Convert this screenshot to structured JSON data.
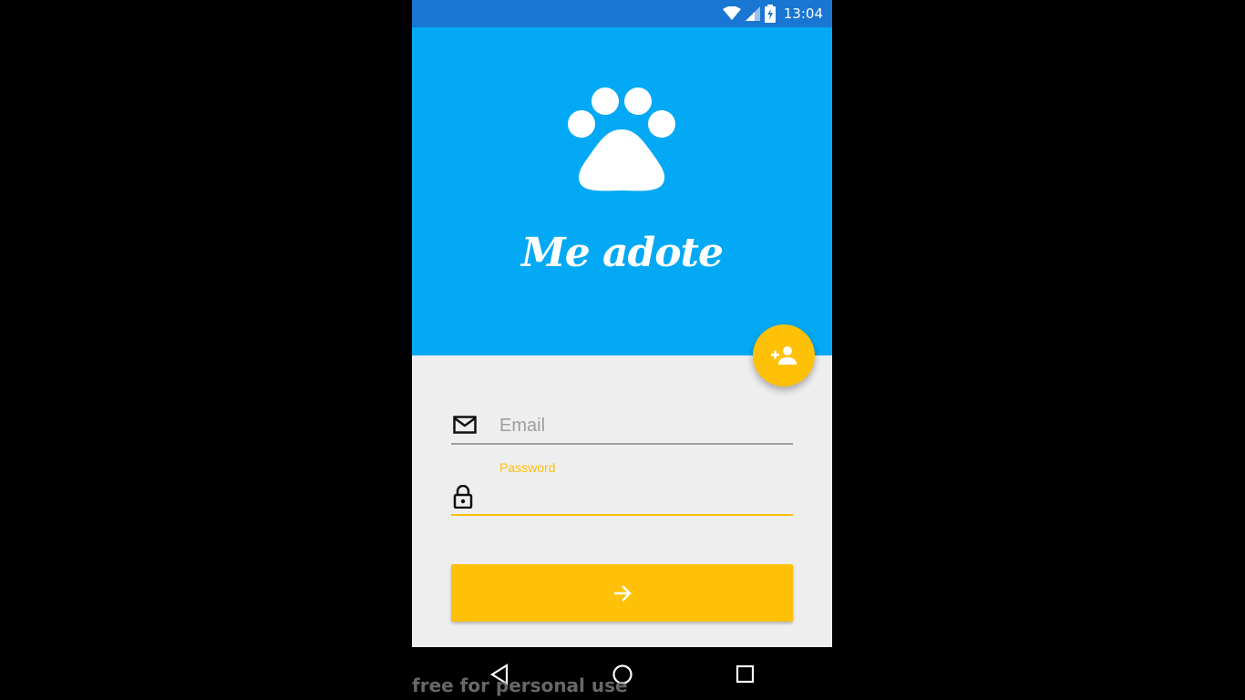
{
  "status_bar": {
    "time": "13:04",
    "icons": [
      "wifi-icon",
      "signal-icon",
      "battery-charging-icon"
    ],
    "color": "#1976d2"
  },
  "header": {
    "logo_icon": "paw-icon",
    "app_title": "Me adote",
    "background": "#03a9f4"
  },
  "fab": {
    "icon": "add-person-icon",
    "color": "#ffc107"
  },
  "form": {
    "email": {
      "icon": "email-icon",
      "placeholder": "Email",
      "value": ""
    },
    "password": {
      "icon": "lock-icon",
      "label": "Password",
      "value": ""
    },
    "submit": {
      "icon": "arrow-right-icon",
      "color": "#ffc107"
    }
  },
  "nav_bar": {
    "buttons": [
      "back-icon",
      "home-icon",
      "recents-icon"
    ]
  },
  "watermark": "free for personal use"
}
